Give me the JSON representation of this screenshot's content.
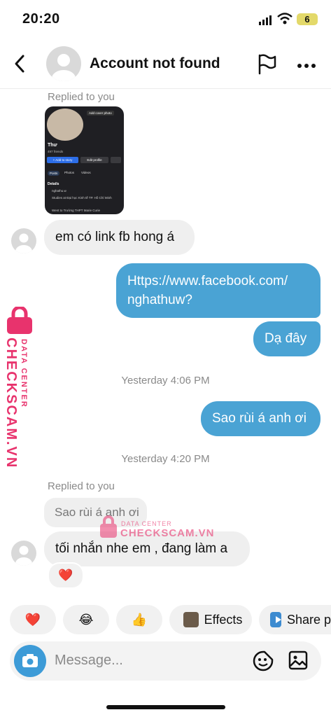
{
  "status_bar": {
    "time": "20:20",
    "battery": "6"
  },
  "header": {
    "title": "Account not found"
  },
  "messages": {
    "replied_1": "Replied to you",
    "shared_screenshot": {
      "add_cover": "Add cover photo",
      "name": "Thư",
      "friends": "497 friends",
      "add_story": "+ Add to story",
      "edit_profile": "Edit profile",
      "tabs": [
        "Posts",
        "Photos",
        "Videos"
      ],
      "details_label": "Details",
      "detail_1": "nghathu.w",
      "detail_2": "Studies at Đại học Kinh tế TP. Hồ Chí Minh",
      "detail_3": "Went to Trường THPT Marie Curie"
    },
    "in_1": "em có link fb hong á",
    "out_1_line1": "Https://www.facebook.com/",
    "out_1_line2": "nghathuw?",
    "out_2": "Dạ đây",
    "ts_1": "Yesterday 4:06 PM",
    "out_3": "Sao rùi á anh ơi",
    "ts_2": "Yesterday 4:20 PM",
    "replied_2": "Replied to you",
    "reply_quote": "Sao rùi á anh ơi",
    "in_2": "tối nhắn nhe em , đang làm a",
    "reaction": "❤️"
  },
  "quick_reactions": [
    {
      "emoji": "❤️"
    },
    {
      "emoji": "😂"
    },
    {
      "emoji": "👍"
    },
    {
      "label": "Effects"
    },
    {
      "label": "Share p"
    }
  ],
  "composer": {
    "placeholder": "Message..."
  },
  "watermark": {
    "side_top": "DATA CENTER",
    "side_main": "CHECKSCAM.VN",
    "center_top": "DATA CENTER",
    "center_main": "CHECKSCAM.VN",
    "color": "#e8336d"
  },
  "colors": {
    "outgoing": "#4aa3d4",
    "incoming": "#efefef",
    "camera": "#3d9bd7"
  }
}
